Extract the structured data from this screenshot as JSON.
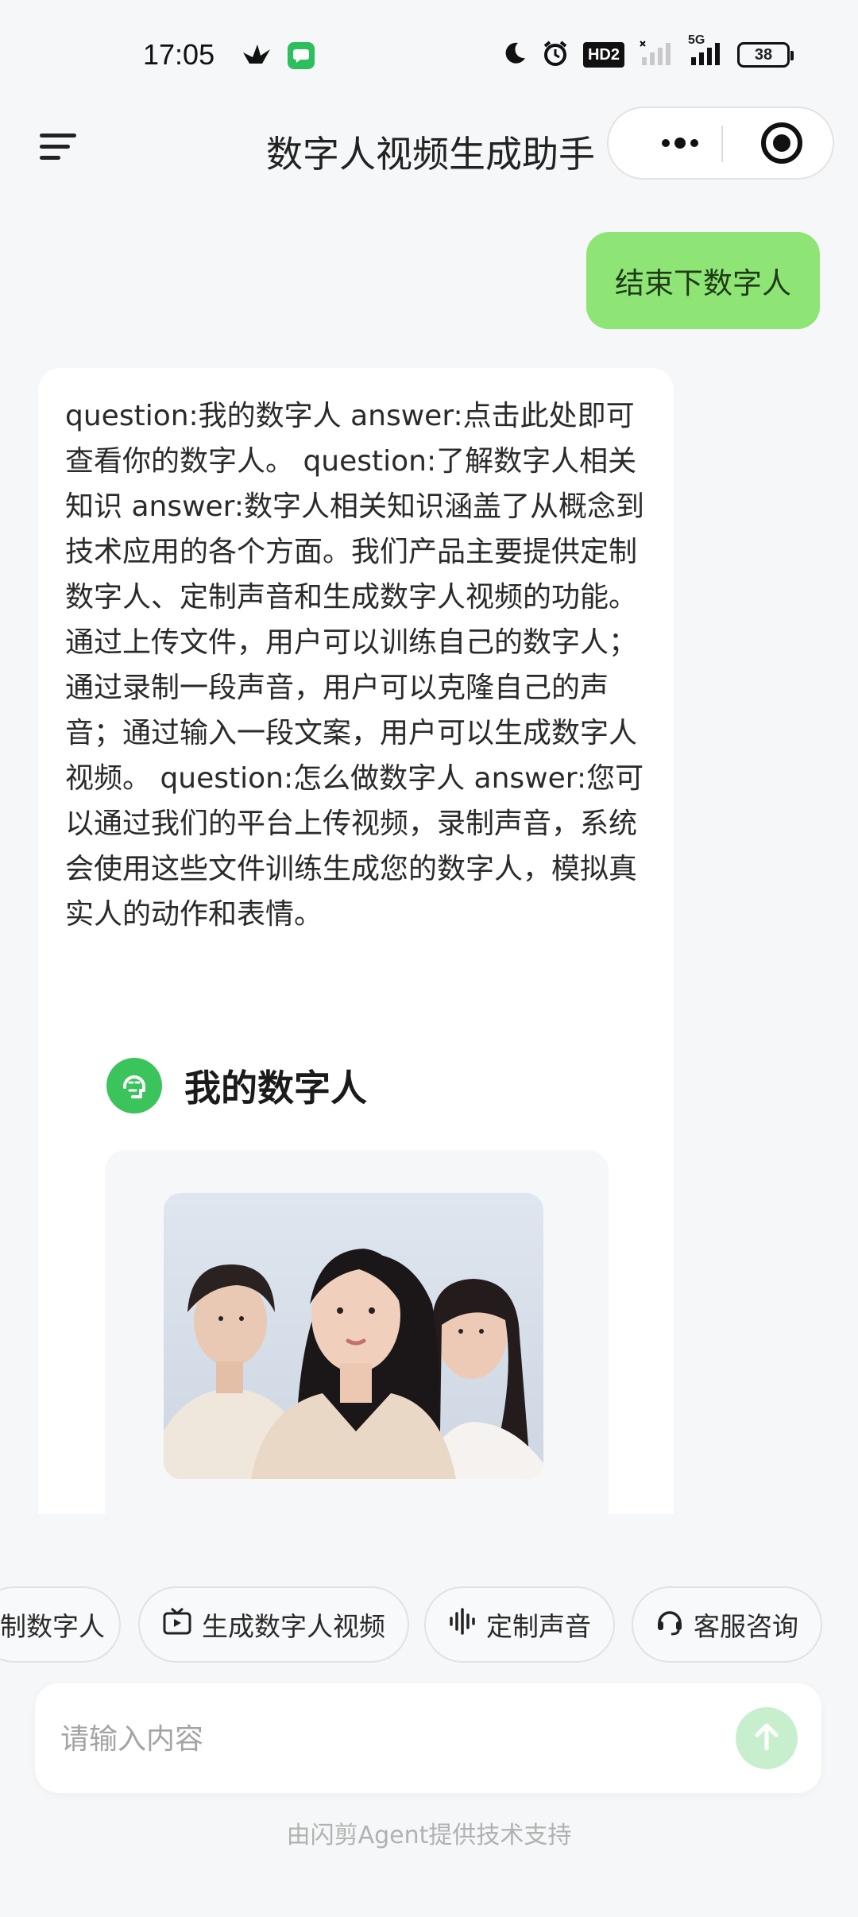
{
  "status_bar": {
    "time": "17:05",
    "battery": "38",
    "hd_label": "HD2",
    "network_label": "5G"
  },
  "header": {
    "title": "数字人视频生成助手"
  },
  "chat": {
    "user_message": "结束下数字人",
    "bot_message": "question:我的数字人 answer:点击此处即可查看你的数字人。 question:了解数字人相关知识 answer:数字人相关知识涵盖了从概念到技术应用的各个方面。我们产品主要提供定制数字人、定制声音和生成数字人视频的功能。通过上传文件，用户可以训练自己的数字人；通过录制一段声音，用户可以克隆自己的声音；通过输入一段文案，用户可以生成数字人视频。 question:怎么做数字人 answer:您可以通过我们的平台上传视频，录制声音，系统会使用这些文件训练生成您的数字人，模拟真实人的动作和表情。",
    "section_title": "我的数字人"
  },
  "quick_actions": [
    {
      "label": "制数字人",
      "icon": "user-icon"
    },
    {
      "label": "生成数字人视频",
      "icon": "video-icon"
    },
    {
      "label": "定制声音",
      "icon": "waveform-icon"
    },
    {
      "label": "客服咨询",
      "icon": "headset-icon"
    }
  ],
  "input": {
    "placeholder": "请输入内容"
  },
  "footer": {
    "text": "由闪剪Agent提供技术支持"
  },
  "colors": {
    "accent_green": "#8ee575",
    "icon_green": "#3bc35c",
    "send_disabled": "#c8efcd"
  }
}
